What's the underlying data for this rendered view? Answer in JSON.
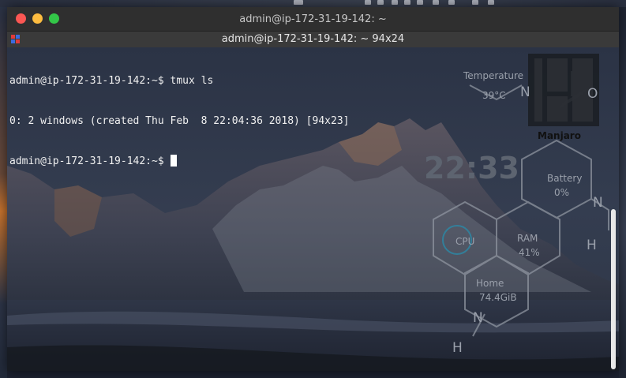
{
  "window": {
    "title": "admin@ip-172-31-19-142: ~",
    "tab_title": "admin@ip-172-31-19-142: ~ 94x24"
  },
  "terminal": {
    "lines": [
      "admin@ip-172-31-19-142:~$ tmux ls",
      "0: 2 windows (created Thu Feb  8 22:04:36 2018) [94x23]",
      "admin@ip-172-31-19-142:~$ "
    ]
  },
  "conky": {
    "temperature_label": "Temperature",
    "temperature_value": "39°C",
    "logo_text": "Manjaro",
    "clock": "22:33",
    "battery_label": "Battery",
    "battery_value": "0%",
    "cpu_label": "CPU",
    "ram_label": "RAM",
    "ram_value": "41%",
    "home_label": "Home",
    "home_value": "74.4GiB",
    "atom_n": "N",
    "atom_o": "O",
    "atom_h": "H"
  },
  "colors": {
    "close": "#fc5753",
    "minimize": "#fdbc40",
    "maximize": "#33c748",
    "cursor": "#ffffff"
  }
}
